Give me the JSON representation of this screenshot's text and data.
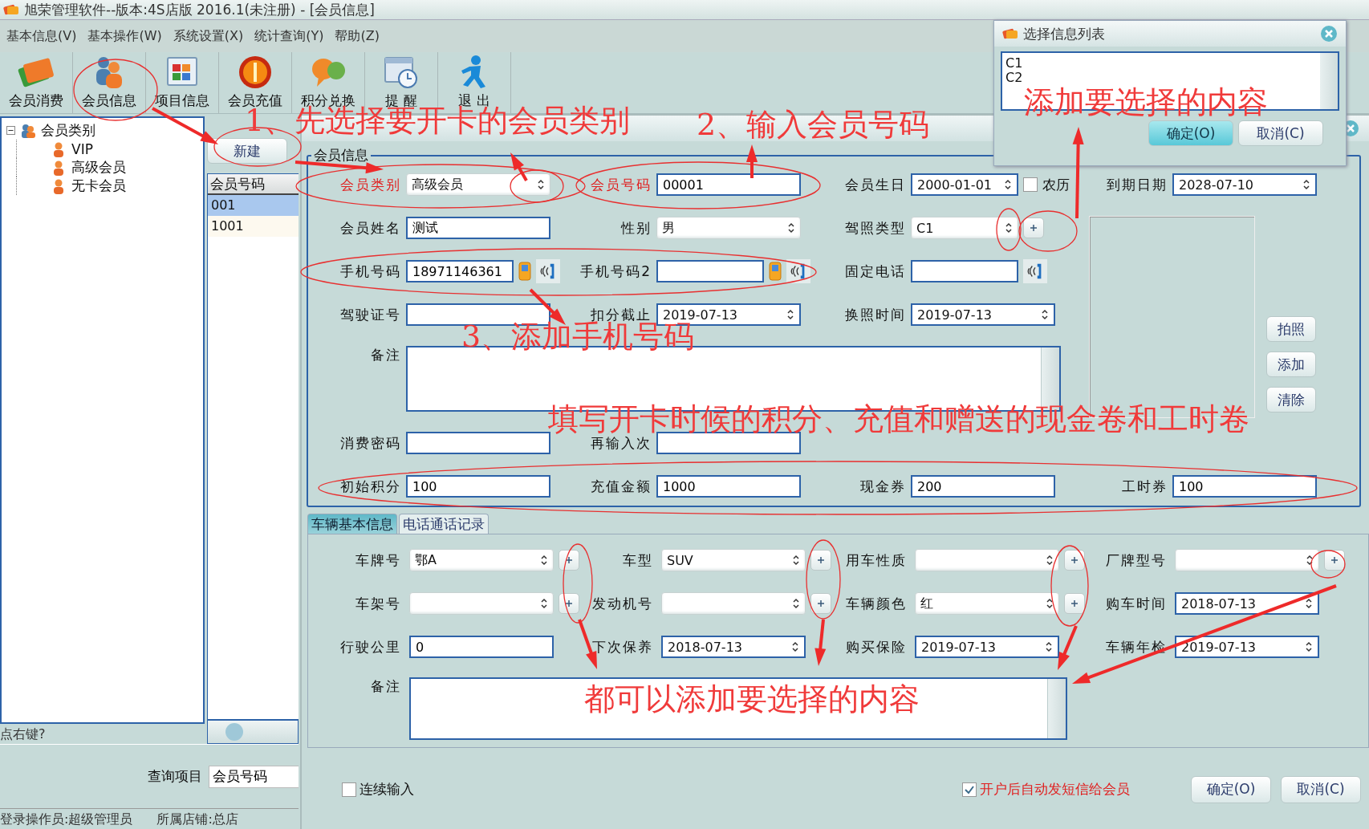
{
  "window": {
    "title": "旭荣管理软件--版本:4S店版 2016.1(未注册) - [会员信息]"
  },
  "menu": [
    "基本信息(V)",
    "基本操作(W)",
    "系统设置(X)",
    "统计查询(Y)",
    "帮助(Z)"
  ],
  "toolbar": [
    "会员消费",
    "会员信息",
    "项目信息",
    "会员充值",
    "积分兑换",
    "提 醒",
    "退 出"
  ],
  "tree": {
    "label": "会员类别",
    "expanded": true,
    "children": [
      {
        "label": "VIP"
      },
      {
        "label": "高级会员"
      },
      {
        "label": "无卡会员"
      }
    ]
  },
  "left_hint": "点右键?",
  "new_button": "新建",
  "member_list": {
    "column": "会员号码",
    "rows": [
      {
        "value": "001",
        "selected": true
      },
      {
        "value": "1001",
        "selected": false
      }
    ]
  },
  "query": {
    "label": "查询项目",
    "value": "会员号码"
  },
  "status_bar": [
    "登录操作员:超级管理员",
    "所属店铺:总店"
  ],
  "member_group": {
    "title": "会员信息",
    "rows": [
      {
        "kind": "fields",
        "cells": [
          {
            "label": "会员类别",
            "kind": "combo",
            "value": "高级会员",
            "required": true
          },
          {
            "label": "会员号码",
            "kind": "text",
            "value": "00001",
            "required": true
          },
          {
            "label": "会员生日",
            "kind": "date",
            "value": "2000-01-01",
            "required": false,
            "extra": {
              "kind": "lunar",
              "label": "农历",
              "checked": false
            }
          },
          {
            "label": "到期日期",
            "kind": "date",
            "value": "2028-07-10",
            "required": false
          }
        ]
      },
      {
        "kind": "fields",
        "cells": [
          {
            "label": "会员姓名",
            "kind": "text",
            "value": "测试",
            "required": false
          },
          {
            "label": "性别",
            "kind": "combo",
            "value": "男",
            "required": false
          },
          {
            "label": "驾照类型",
            "kind": "combo",
            "value": "C1",
            "required": false,
            "extra": {
              "kind": "add"
            }
          }
        ]
      },
      {
        "kind": "fields",
        "cells": [
          {
            "label": "手机号码",
            "kind": "text",
            "value": "18971146361",
            "required": false,
            "extra": {
              "kind": "sms_dial"
            }
          },
          {
            "label": "手机号码2",
            "kind": "text",
            "required": false,
            "extra": {
              "kind": "sms_dial"
            }
          },
          {
            "label": "固定电话",
            "kind": "text",
            "required": false,
            "extra": {
              "kind": "dial"
            }
          }
        ]
      },
      {
        "kind": "fields",
        "cells": [
          {
            "label": "驾驶证号",
            "kind": "text",
            "required": false
          },
          {
            "label": "扣分截止",
            "kind": "date",
            "value": "2019-07-13",
            "required": false
          },
          {
            "label": "换照时间",
            "kind": "date",
            "value": "2019-07-13",
            "required": false
          }
        ]
      },
      {
        "kind": "remark",
        "label": "备注"
      },
      {
        "kind": "fields",
        "cells": [
          {
            "label": "消费密码",
            "kind": "text",
            "required": false
          },
          {
            "label": "再输入次",
            "kind": "text",
            "required": false
          }
        ]
      },
      {
        "kind": "fields",
        "cells": [
          {
            "label": "初始积分",
            "kind": "text",
            "value": "100",
            "required": false
          },
          {
            "label": "充值金额",
            "kind": "text",
            "value": "1000",
            "required": false
          },
          {
            "label": "现金券",
            "kind": "text",
            "value": "200",
            "required": false
          },
          {
            "label": "工时券",
            "kind": "text",
            "value": "100",
            "required": false
          }
        ]
      }
    ],
    "photo_buttons": [
      "拍照",
      "添加",
      "清除"
    ]
  },
  "tabs": [
    {
      "label": "车辆基本信息",
      "selected": true
    },
    {
      "label": "电话通话记录",
      "selected": false
    }
  ],
  "vehicle": {
    "rows": [
      [
        {
          "label": "车牌号",
          "kind": "combo",
          "value": "鄂A",
          "add": true
        },
        {
          "label": "车型",
          "kind": "combo",
          "value": "SUV",
          "add": true
        },
        {
          "label": "用车性质",
          "kind": "combo",
          "add": true
        },
        {
          "label": "厂牌型号",
          "kind": "combo",
          "add": true
        }
      ],
      [
        {
          "label": "车架号",
          "kind": "combo",
          "add": true
        },
        {
          "label": "发动机号",
          "kind": "combo",
          "add": true
        },
        {
          "label": "车辆颜色",
          "kind": "combo",
          "value": "红",
          "add": true
        },
        {
          "label": "购车时间",
          "kind": "date",
          "value": "2018-07-13",
          "add": false
        }
      ],
      [
        {
          "label": "行驶公里",
          "kind": "text",
          "value": "0",
          "add": false
        },
        {
          "label": "下次保养",
          "kind": "date",
          "value": "2018-07-13",
          "add": false
        },
        {
          "label": "购买保险",
          "kind": "date",
          "value": "2019-07-13",
          "add": false
        },
        {
          "label": "车辆年检",
          "kind": "date",
          "value": "2019-07-13",
          "add": false
        }
      ]
    ],
    "remark_label": "备注"
  },
  "footer": {
    "checks": [
      {
        "label": "连续输入",
        "checked": false
      },
      {
        "label": "开户后自动发短信给会员",
        "checked": true
      }
    ],
    "buttons": [
      "确定(O)",
      "取消(C)"
    ]
  },
  "popup": {
    "title": "选择信息列表",
    "items": [
      "C1",
      "C2"
    ],
    "buttons": [
      {
        "label": "确定(O)",
        "default": true
      },
      {
        "label": "取消(C)",
        "default": false
      }
    ]
  },
  "annotations": [
    {
      "text": "1、先选择要开卡的会员类别"
    },
    {
      "text": "2、输入会员号码"
    },
    {
      "text": "添加要选择的内容"
    },
    {
      "text": "3、添加手机号码"
    },
    {
      "text": "填写开卡时候的积分、充值和赠送的现金卷和工时卷"
    },
    {
      "text": "都可以添加要选择的内容"
    }
  ]
}
